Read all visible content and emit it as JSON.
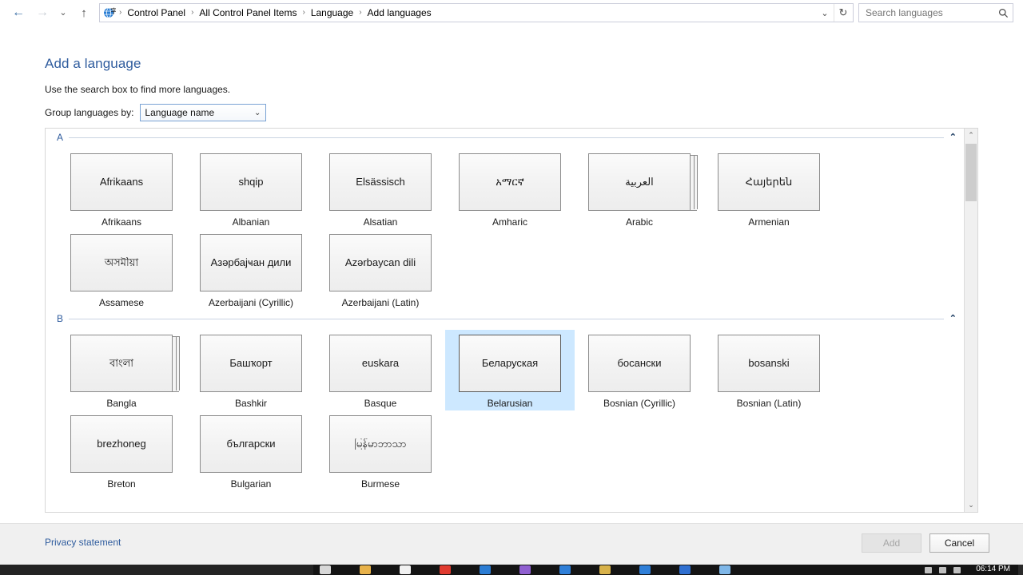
{
  "window": {
    "addressbar": {
      "icon": "language-globe-icon",
      "crumbs": [
        "Control Panel",
        "All Control Panel Items",
        "Language",
        "Add languages"
      ],
      "separator": "›",
      "history_caret": "⌄",
      "refresh": "↻",
      "back": "←",
      "forward": "→",
      "up": "↑"
    },
    "search": {
      "placeholder": "Search languages",
      "value": "",
      "icon": "search-icon"
    }
  },
  "page": {
    "title": "Add a language",
    "subtitle": "Use the search box to find more languages.",
    "group_label": "Group languages by:",
    "group_value": "Language name",
    "group_options": [
      "Language name"
    ],
    "caret": "⌄"
  },
  "list": {
    "sections": [
      {
        "letter": "A",
        "collapse_chevron": "⌃",
        "tiles": [
          {
            "native": "Afrikaans",
            "label": "Afrikaans",
            "variants": 1,
            "selected": false
          },
          {
            "native": "shqip",
            "label": "Albanian",
            "variants": 1,
            "selected": false
          },
          {
            "native": "Elsässisch",
            "label": "Alsatian",
            "variants": 1,
            "selected": false
          },
          {
            "native": "አማርኛ",
            "label": "Amharic",
            "variants": 1,
            "selected": false
          },
          {
            "native": "العربية",
            "label": "Arabic",
            "variants": 3,
            "selected": false
          },
          {
            "native": "Հայերեն",
            "label": "Armenian",
            "variants": 1,
            "selected": false
          },
          {
            "native": "অসমীয়া",
            "label": "Assamese",
            "variants": 1,
            "selected": false
          },
          {
            "native": "Азәрбајҹан дили",
            "label": "Azerbaijani (Cyrillic)",
            "variants": 1,
            "selected": false
          },
          {
            "native": "Azərbaycan dili",
            "label": "Azerbaijani (Latin)",
            "variants": 1,
            "selected": false
          }
        ]
      },
      {
        "letter": "B",
        "collapse_chevron": "⌃",
        "tiles": [
          {
            "native": "বাংলা",
            "label": "Bangla",
            "variants": 3,
            "selected": false
          },
          {
            "native": "Башҡорт",
            "label": "Bashkir",
            "variants": 1,
            "selected": false
          },
          {
            "native": "euskara",
            "label": "Basque",
            "variants": 1,
            "selected": false
          },
          {
            "native": "Беларуская",
            "label": "Belarusian",
            "variants": 1,
            "selected": true
          },
          {
            "native": "босански",
            "label": "Bosnian (Cyrillic)",
            "variants": 1,
            "selected": false
          },
          {
            "native": "bosanski",
            "label": "Bosnian (Latin)",
            "variants": 1,
            "selected": false
          },
          {
            "native": "brezhoneg",
            "label": "Breton",
            "variants": 1,
            "selected": false
          },
          {
            "native": "български",
            "label": "Bulgarian",
            "variants": 1,
            "selected": false
          },
          {
            "native": "မြန်မာဘာသာ",
            "label": "Burmese",
            "variants": 1,
            "selected": false
          }
        ]
      }
    ],
    "scrollbar": {
      "up_arrow": "⌃",
      "down_arrow": "⌄"
    }
  },
  "footer": {
    "privacy_link": "Privacy statement",
    "add_label": "Add",
    "add_enabled": false,
    "cancel_label": "Cancel"
  },
  "taskbar": {
    "clock": "06:14 PM",
    "icon_colors": [
      "#d8d8d8",
      "#e8b24a",
      "#f1f1f1",
      "#e03a2f",
      "#2b7cd3",
      "#8f5fd0",
      "#2f7fd8",
      "#d8b24a",
      "#2f7fd8",
      "#2f6fd0",
      "#7fb7e8"
    ]
  },
  "colors": {
    "accent": "#2f5c9e",
    "selection": "#cde8ff",
    "tile_border": "#8b8b8b",
    "footer_bg": "#f0f0f0"
  }
}
